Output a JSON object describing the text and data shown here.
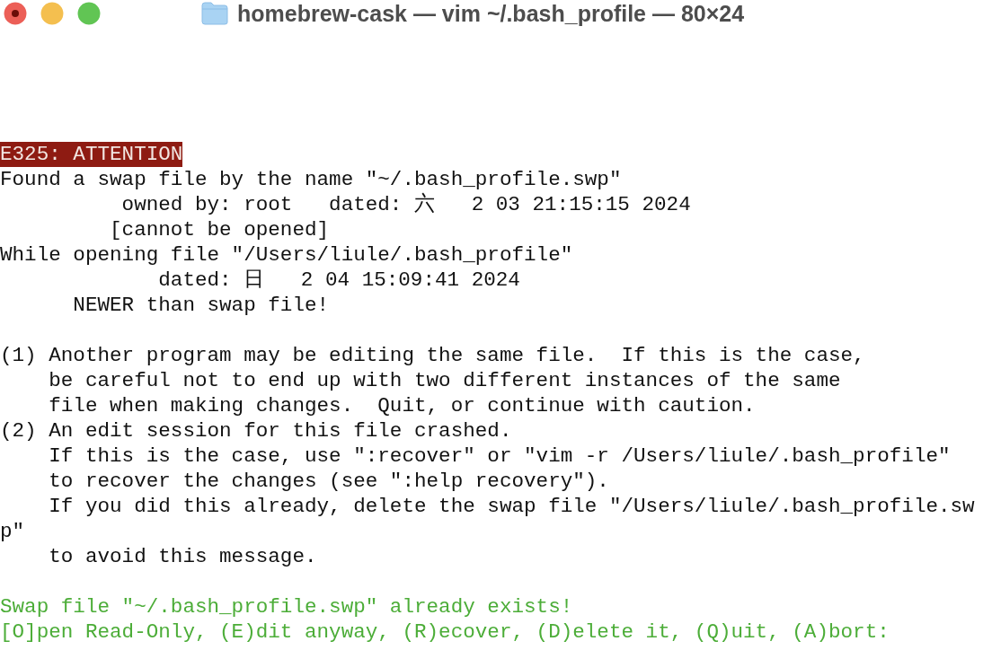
{
  "window": {
    "title": "homebrew-cask — vim ~/.bash_profile — 80×24"
  },
  "terminal": {
    "lines": [
      {
        "kind": "error",
        "text": "E325: ATTENTION"
      },
      {
        "kind": "normal",
        "text": "Found a swap file by the name \"~/.bash_profile.swp\""
      },
      {
        "kind": "normal",
        "text": "          owned by: root   dated: 六   2 03 21:15:15 2024"
      },
      {
        "kind": "normal",
        "text": "         [cannot be opened]"
      },
      {
        "kind": "normal",
        "text": "While opening file \"/Users/liule/.bash_profile\""
      },
      {
        "kind": "normal",
        "text": "             dated: 日   2 04 15:09:41 2024"
      },
      {
        "kind": "normal",
        "text": "      NEWER than swap file!"
      },
      {
        "kind": "blank"
      },
      {
        "kind": "normal",
        "text": "(1) Another program may be editing the same file.  If this is the case,"
      },
      {
        "kind": "normal",
        "text": "    be careful not to end up with two different instances of the same"
      },
      {
        "kind": "normal",
        "text": "    file when making changes.  Quit, or continue with caution."
      },
      {
        "kind": "normal",
        "text": "(2) An edit session for this file crashed."
      },
      {
        "kind": "normal",
        "text": "    If this is the case, use \":recover\" or \"vim -r /Users/liule/.bash_profile\""
      },
      {
        "kind": "normal",
        "text": "    to recover the changes (see \":help recovery\")."
      },
      {
        "kind": "normal",
        "text": "    If you did this already, delete the swap file \"/Users/liule/.bash_profile.sw"
      },
      {
        "kind": "normal",
        "text": "p\""
      },
      {
        "kind": "normal",
        "text": "    to avoid this message."
      },
      {
        "kind": "blank"
      },
      {
        "kind": "prompt",
        "text": "Swap file \"~/.bash_profile.swp\" already exists!"
      },
      {
        "kind": "prompt",
        "text": "[O]pen Read-Only, (E)dit anyway, (R)ecover, (D)elete it, (Q)uit, (A)bort:"
      }
    ]
  }
}
